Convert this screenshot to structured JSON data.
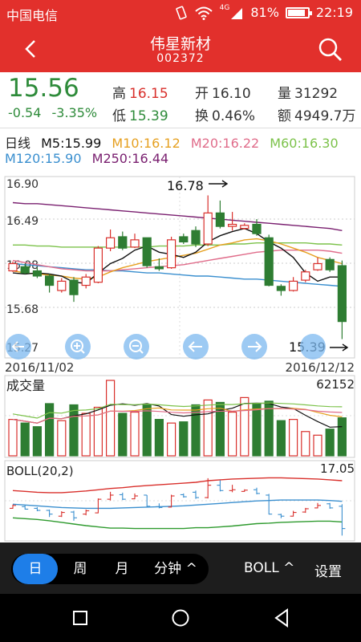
{
  "status_bar": {
    "carrier": "中国电信",
    "network": "4G",
    "battery": "81%",
    "time": "22:19"
  },
  "header": {
    "title": "伟星新材",
    "code": "002372",
    "back_icon": "back-arrow-icon",
    "search_icon": "search-icon"
  },
  "quote": {
    "price": "15.56",
    "change": "-0.54",
    "change_pct": "-3.35%",
    "high_label": "高",
    "high": "16.15",
    "low_label": "低",
    "low": "15.39",
    "open_label": "开",
    "open": "16.10",
    "turnover_label": "换",
    "turnover": "0.46%",
    "volume_label": "量",
    "volume": "31292",
    "amount_label": "额",
    "amount": "4949.7万"
  },
  "ma_legend": {
    "period": "日线",
    "ma5": "M5:15.99",
    "ma10": "M10:16.12",
    "ma20": "M20:16.22",
    "ma60": "M60:16.30",
    "ma120": "M120:15.90",
    "ma250": "M250:16.44"
  },
  "colors": {
    "up": "#d9302c",
    "down": "#2e7d32",
    "ma5": "#111111",
    "ma10": "#e6a020",
    "ma20": "#e06c8a",
    "ma60": "#7cc24a",
    "ma120": "#3a8fcf",
    "ma250": "#7a2070"
  },
  "chart_data": {
    "type": "candlestick",
    "y_ticks": [
      "16.90",
      "16.49",
      "16.08",
      "15.68",
      "15.27"
    ],
    "ylim": [
      15.27,
      16.9
    ],
    "x_start": "2016/11/02",
    "x_end": "2016/12/12",
    "annotation_high": "16.78",
    "annotation_low": "15.39",
    "candles": [
      {
        "o": 16.05,
        "c": 16.12,
        "h": 16.14,
        "l": 16.04
      },
      {
        "o": 16.09,
        "c": 16.03,
        "h": 16.12,
        "l": 16.02
      },
      {
        "o": 16.05,
        "c": 16.0,
        "h": 16.08,
        "l": 15.98
      },
      {
        "o": 16.0,
        "c": 15.91,
        "h": 16.02,
        "l": 15.84
      },
      {
        "o": 15.86,
        "c": 15.95,
        "h": 15.98,
        "l": 15.84
      },
      {
        "o": 15.96,
        "c": 15.82,
        "h": 15.99,
        "l": 15.75
      },
      {
        "o": 15.91,
        "c": 15.99,
        "h": 16.02,
        "l": 15.88
      },
      {
        "o": 15.94,
        "c": 16.27,
        "h": 16.29,
        "l": 15.93
      },
      {
        "o": 16.27,
        "c": 16.37,
        "h": 16.45,
        "l": 16.24
      },
      {
        "o": 16.38,
        "c": 16.27,
        "h": 16.43,
        "l": 16.25
      },
      {
        "o": 16.28,
        "c": 16.35,
        "h": 16.41,
        "l": 16.27
      },
      {
        "o": 16.37,
        "c": 16.1,
        "h": 16.37,
        "l": 16.08
      },
      {
        "o": 16.09,
        "c": 16.07,
        "h": 16.17,
        "l": 16.05
      },
      {
        "o": 16.08,
        "c": 16.35,
        "h": 16.38,
        "l": 16.07
      },
      {
        "o": 16.38,
        "c": 16.33,
        "h": 16.41,
        "l": 16.31
      },
      {
        "o": 16.44,
        "c": 16.31,
        "h": 16.48,
        "l": 16.28
      },
      {
        "o": 16.31,
        "c": 16.61,
        "h": 16.78,
        "l": 16.29
      },
      {
        "o": 16.61,
        "c": 16.48,
        "h": 16.73,
        "l": 16.46
      },
      {
        "o": 16.48,
        "c": 16.5,
        "h": 16.62,
        "l": 16.44
      },
      {
        "o": 16.46,
        "c": 16.49,
        "h": 16.51,
        "l": 16.45
      },
      {
        "o": 16.5,
        "c": 16.41,
        "h": 16.55,
        "l": 16.39
      },
      {
        "o": 16.37,
        "c": 15.91,
        "h": 16.4,
        "l": 15.9
      },
      {
        "o": 15.9,
        "c": 15.86,
        "h": 15.92,
        "l": 15.81
      },
      {
        "o": 15.86,
        "c": 15.95,
        "h": 15.99,
        "l": 15.85
      },
      {
        "o": 15.96,
        "c": 16.04,
        "h": 16.06,
        "l": 15.94
      },
      {
        "o": 16.06,
        "c": 16.12,
        "h": 16.18,
        "l": 16.05
      },
      {
        "o": 16.16,
        "c": 16.06,
        "h": 16.18,
        "l": 16.04
      },
      {
        "o": 16.1,
        "c": 15.56,
        "h": 16.15,
        "l": 15.39
      }
    ],
    "ma5": [
      16.03,
      16.02,
      16.03,
      16.02,
      16.0,
      15.94,
      15.93,
      16.03,
      16.12,
      16.17,
      16.25,
      16.29,
      16.23,
      16.21,
      16.18,
      16.23,
      16.33,
      16.39,
      16.43,
      16.46,
      16.41,
      16.33,
      16.27,
      16.18,
      16.03,
      15.95,
      15.99,
      15.99
    ],
    "ma10": [
      16.05,
      16.03,
      16.02,
      16.01,
      16.0,
      15.98,
      15.97,
      15.99,
      16.04,
      16.08,
      16.11,
      16.14,
      16.16,
      16.18,
      16.2,
      16.22,
      16.26,
      16.3,
      16.32,
      16.35,
      16.36,
      16.34,
      16.31,
      16.27,
      16.23,
      16.18,
      16.15,
      16.12
    ],
    "ma20": [
      16.15,
      16.13,
      16.11,
      16.09,
      16.07,
      16.06,
      16.05,
      16.05,
      16.05,
      16.06,
      16.07,
      16.08,
      16.09,
      16.1,
      16.11,
      16.13,
      16.15,
      16.17,
      16.19,
      16.21,
      16.23,
      16.24,
      16.25,
      16.25,
      16.25,
      16.25,
      16.24,
      16.22
    ],
    "ma60": [
      16.3,
      16.3,
      16.29,
      16.29,
      16.28,
      16.28,
      16.28,
      16.28,
      16.28,
      16.28,
      16.28,
      16.28,
      16.29,
      16.29,
      16.29,
      16.3,
      16.3,
      16.3,
      16.31,
      16.31,
      16.32,
      16.32,
      16.32,
      16.32,
      16.32,
      16.31,
      16.31,
      16.3
    ],
    "ma120": [
      16.12,
      16.11,
      16.1,
      16.09,
      16.08,
      16.07,
      16.06,
      16.06,
      16.05,
      16.05,
      16.04,
      16.03,
      16.03,
      16.02,
      16.01,
      16.0,
      16.0,
      15.99,
      15.98,
      15.97,
      15.97,
      15.96,
      15.95,
      15.94,
      15.93,
      15.92,
      15.91,
      15.9
    ],
    "ma250": [
      16.71,
      16.7,
      16.7,
      16.69,
      16.68,
      16.67,
      16.66,
      16.65,
      16.64,
      16.63,
      16.62,
      16.61,
      16.6,
      16.59,
      16.58,
      16.57,
      16.56,
      16.55,
      16.54,
      16.53,
      16.52,
      16.51,
      16.5,
      16.49,
      16.48,
      16.47,
      16.46,
      16.44
    ],
    "volume": {
      "label": "成交量",
      "max_label": "62152",
      "max": 62152,
      "values": [
        30000,
        27000,
        24000,
        43000,
        29000,
        42000,
        35000,
        40000,
        62152,
        35000,
        36000,
        42000,
        30000,
        27000,
        28000,
        42000,
        46000,
        44000,
        36000,
        48000,
        43000,
        45000,
        29000,
        30000,
        20000,
        17000,
        22000,
        31292
      ]
    },
    "boll": {
      "label": "BOLL(20,2)",
      "max_label": "17.05",
      "ylim": [
        15.3,
        17.05
      ],
      "upper": [
        16.48,
        16.46,
        16.44,
        16.43,
        16.43,
        16.45,
        16.47,
        16.5,
        16.53,
        16.55,
        16.58,
        16.6,
        16.62,
        16.64,
        16.66,
        16.68,
        16.72,
        16.74,
        16.76,
        16.77,
        16.78,
        16.79,
        16.79,
        16.78,
        16.77,
        16.76,
        16.74,
        16.72
      ],
      "mid": [
        16.15,
        16.13,
        16.11,
        16.09,
        16.07,
        16.06,
        16.05,
        16.05,
        16.05,
        16.06,
        16.07,
        16.08,
        16.09,
        16.1,
        16.11,
        16.13,
        16.15,
        16.17,
        16.19,
        16.21,
        16.23,
        16.24,
        16.25,
        16.25,
        16.25,
        16.25,
        16.24,
        16.22
      ],
      "lower": [
        15.82,
        15.8,
        15.78,
        15.75,
        15.71,
        15.67,
        15.63,
        15.6,
        15.57,
        15.57,
        15.56,
        15.56,
        15.56,
        15.56,
        15.56,
        15.58,
        15.58,
        15.6,
        15.62,
        15.65,
        15.68,
        15.69,
        15.71,
        15.72,
        15.73,
        15.74,
        15.74,
        15.72
      ]
    }
  },
  "toolbar": {
    "tabs": [
      "日",
      "周",
      "月",
      "分钟 ^"
    ],
    "active_tab": "日",
    "indicator_button": "BOLL ^",
    "settings_button": "设置"
  }
}
